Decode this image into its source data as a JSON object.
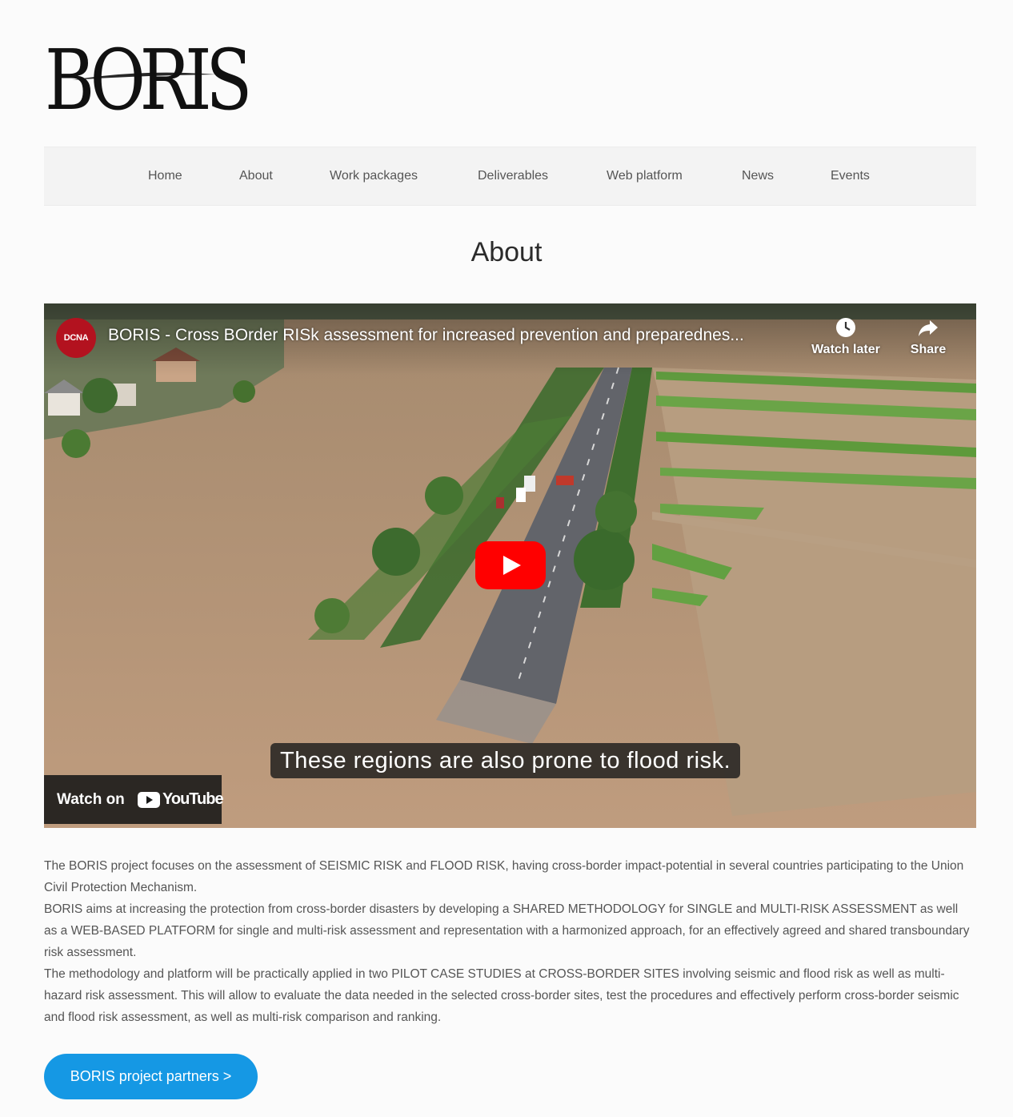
{
  "site": {
    "logo_text": "BORIS"
  },
  "nav": {
    "items": [
      {
        "label": "Home"
      },
      {
        "label": "About"
      },
      {
        "label": "Work packages"
      },
      {
        "label": "Deliverables"
      },
      {
        "label": "Web platform"
      },
      {
        "label": "News"
      },
      {
        "label": "Events"
      }
    ]
  },
  "page": {
    "title": "About"
  },
  "video": {
    "channel_avatar_text": "DCNA",
    "title": "BORIS - Cross BOrder RISk assessment for increased prevention and preparednes...",
    "watch_later_label": "Watch later",
    "share_label": "Share",
    "caption": "These regions are also prone to flood risk.",
    "watch_on_label": "Watch on",
    "youtube_label": "YouTube"
  },
  "body": {
    "paragraphs": [
      "The BORIS project focuses on the assessment of SEISMIC RISK and FLOOD RISK, having cross-border impact-potential in several countries participating to the Union Civil Protection Mechanism.",
      "BORIS aims at increasing the protection from cross-border disasters by developing a SHARED METHODOLOGY for SINGLE and MULTI-RISK ASSESSMENT as well as a WEB-BASED PLATFORM for single and multi-risk assessment and representation with a harmonized approach, for an effectively agreed and shared transboundary risk assessment.",
      "The methodology and platform will be practically applied in two PILOT CASE STUDIES at CROSS-BORDER SITES involving seismic and flood risk as well as multi-hazard risk assessment. This will allow to evaluate the data needed in the selected cross-border sites, test the procedures and effectively perform cross-border seismic and flood risk assessment, as well as multi-risk comparison and ranking."
    ]
  },
  "cta": {
    "partners_label": "BORIS project partners >"
  },
  "colors": {
    "accent": "#1598e4",
    "youtube_red": "#ff0000",
    "flood_water": "#b49478"
  }
}
